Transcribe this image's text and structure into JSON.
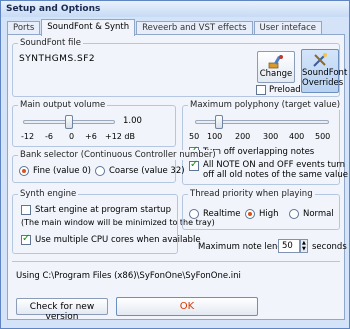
{
  "window": {
    "title": "Setup and Options"
  },
  "tabs": [
    {
      "label": "Ports",
      "active": false
    },
    {
      "label": "SoundFont & Synth",
      "active": true
    },
    {
      "label": "Reveerb and VST effects",
      "active": false
    },
    {
      "label": "User inteface",
      "active": false
    }
  ],
  "soundfont": {
    "legend": "SoundFont file",
    "filename": "SYNTHGMS.SF2",
    "change_label": "Change",
    "preload_label": "Preload",
    "preload_checked": false,
    "overrides_label_1": "SoundFont",
    "overrides_label_2": "Overrides",
    "change_icon": "paint-brush-icon",
    "overrides_icon": "wand-tools-icon"
  },
  "volume": {
    "legend": "Main output volume",
    "value_label": "1.00",
    "ticks": [
      "-12",
      "-6",
      "0",
      "+6",
      "+12 dB"
    ],
    "level_db": 0
  },
  "polyphony": {
    "legend": "Maximum polyphony (target value)",
    "ticks": [
      "50",
      "100",
      "200",
      "300",
      "400",
      "500"
    ],
    "level": 100,
    "turn_off_label": "Turn off overlapping notes",
    "turn_off_checked": true,
    "all_note_label_1": "All NOTE ON and OFF events turn",
    "all_note_label_2": "off all old notes of the same value",
    "all_note_checked": true
  },
  "bank": {
    "legend": "Bank selector (Continuous Controller number)",
    "fine_label": "Fine (value 0)",
    "coarse_label": "Coarse (value 32)",
    "selected": "fine"
  },
  "engine": {
    "legend": "Synth engine",
    "startup_label": "Start engine at program startup",
    "startup_note": "(The main window will be minimized to the tray)",
    "startup_checked": false,
    "cpu_label": "Use multiple CPU cores when available",
    "cpu_checked": true
  },
  "priority": {
    "legend": "Thread priority when playing",
    "options": [
      "Realtime",
      "High",
      "Normal"
    ],
    "selected": "High"
  },
  "note_length": {
    "label": "Maximum note length",
    "value": "50",
    "unit": "seconds"
  },
  "status": {
    "path_text": "Using C:\\Program Files (x86)\\SyFonOne\\SyFonOne.ini"
  },
  "footer": {
    "check_version_label": "Check for new version",
    "ok_label": "OK"
  },
  "colors": {
    "ok_text": "#d43a00",
    "accent": "#d8541e",
    "check_green": "#1b8a1b"
  }
}
